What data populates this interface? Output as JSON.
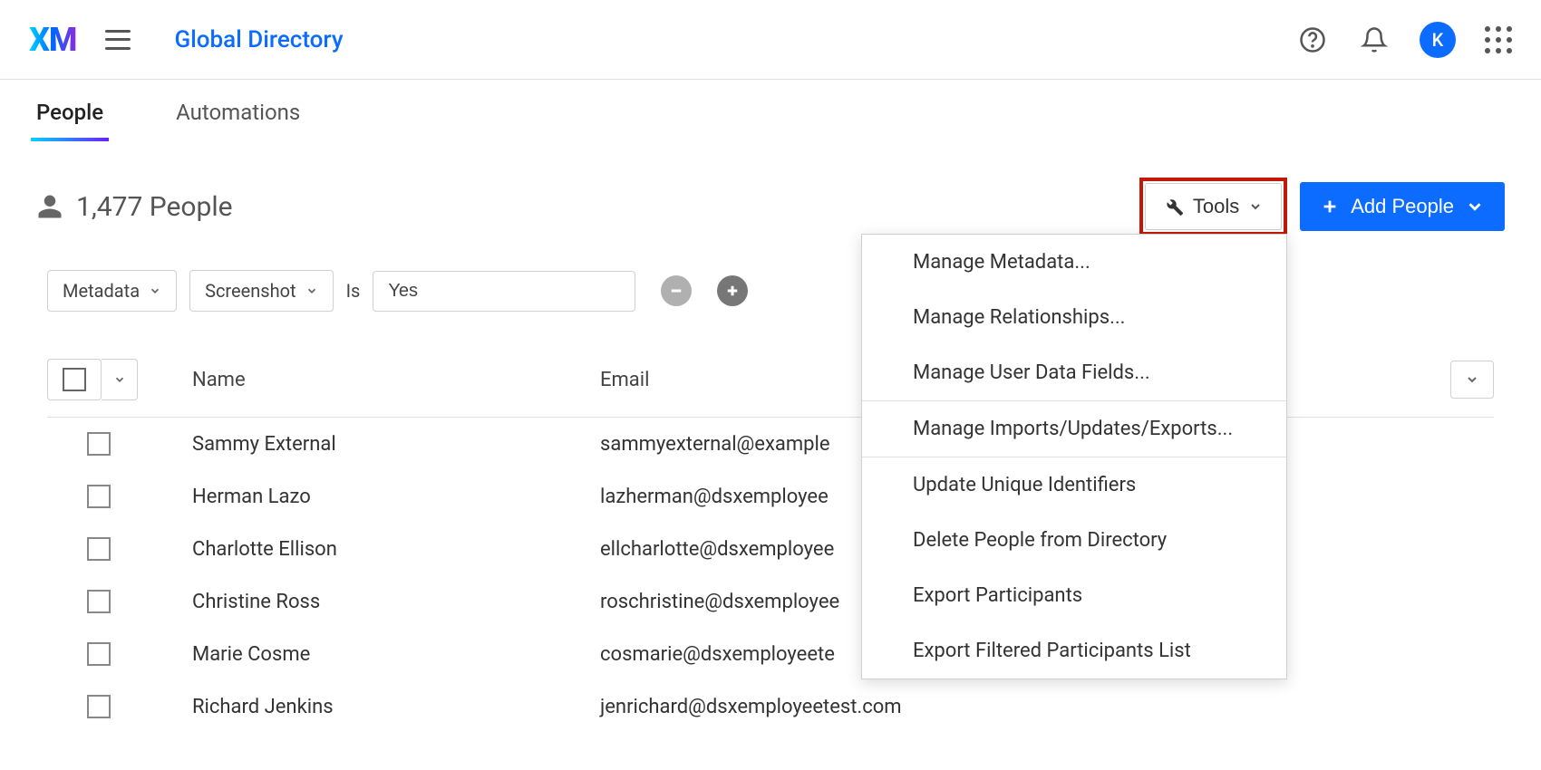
{
  "header": {
    "logo": "XM",
    "breadcrumb": "Global Directory",
    "avatar_initial": "K"
  },
  "tabs": [
    {
      "label": "People",
      "active": true
    },
    {
      "label": "Automations",
      "active": false
    }
  ],
  "page": {
    "count_label": "1,477 People",
    "tools_label": "Tools",
    "add_people_label": "Add People"
  },
  "filters": {
    "type_label": "Metadata",
    "field_label": "Screenshot",
    "operator_label": "Is",
    "value": "Yes"
  },
  "table": {
    "columns": {
      "name": "Name",
      "email": "Email"
    },
    "rows": [
      {
        "name": "Sammy External",
        "email": "sammyexternal@example"
      },
      {
        "name": "Herman Lazo",
        "email": "lazherman@dsxemployee"
      },
      {
        "name": "Charlotte Ellison",
        "email": "ellcharlotte@dsxemployee"
      },
      {
        "name": "Christine Ross",
        "email": "roschristine@dsxemployee"
      },
      {
        "name": "Marie Cosme",
        "email": "cosmarie@dsxemployeete"
      },
      {
        "name": "Richard Jenkins",
        "email": "jenrichard@dsxemployeetest.com"
      }
    ]
  },
  "tools_menu": {
    "groups": [
      [
        "Manage Metadata...",
        "Manage Relationships...",
        "Manage User Data Fields..."
      ],
      [
        "Manage Imports/Updates/Exports..."
      ],
      [
        "Update Unique Identifiers",
        "Delete People from Directory",
        "Export Participants",
        "Export Filtered Participants List"
      ]
    ]
  }
}
